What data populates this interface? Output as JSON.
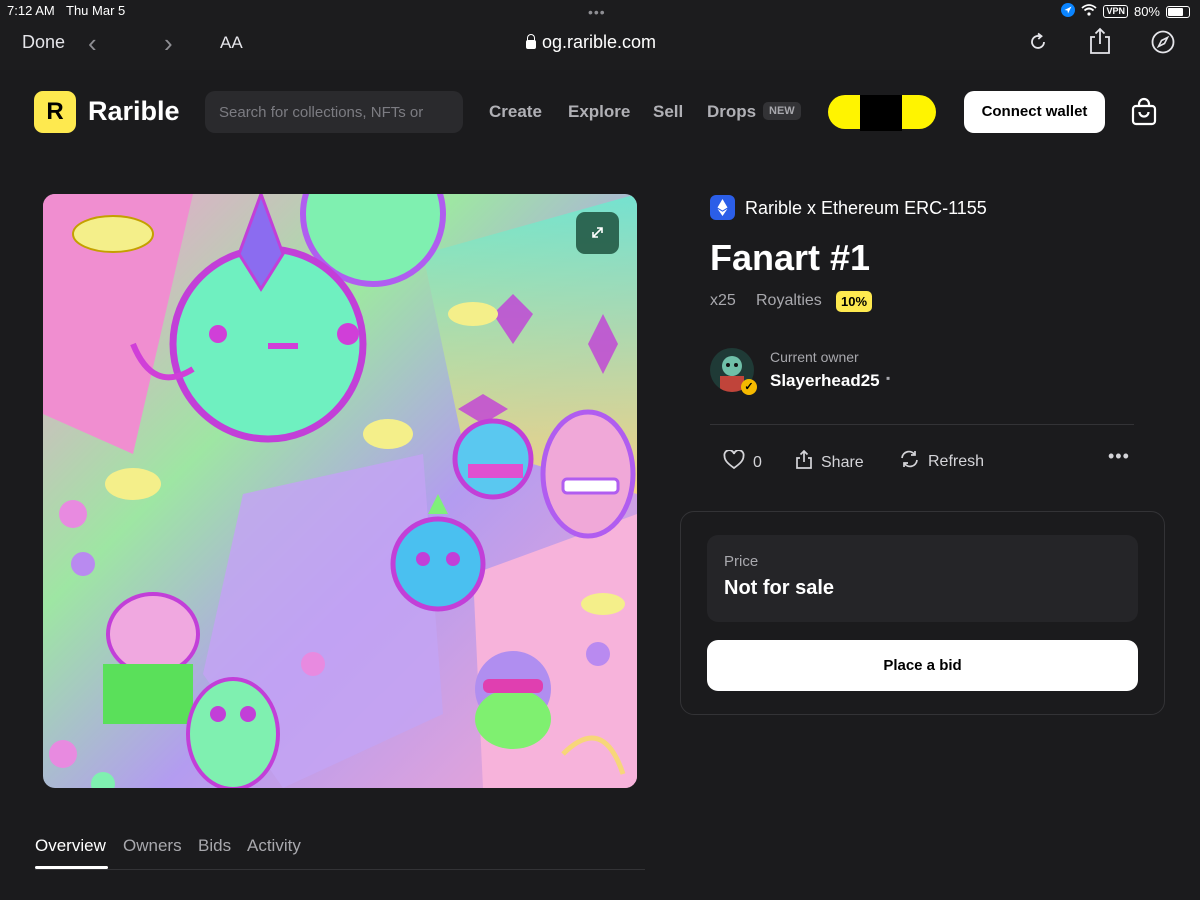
{
  "status_bar": {
    "time": "7:12 AM",
    "date": "Thu Mar 5",
    "vpn": "VPN",
    "battery": "80%"
  },
  "browser": {
    "done_label": "Done",
    "text_size_label": "AA",
    "url": "og.rarible.com"
  },
  "nav": {
    "logo_letter": "R",
    "logo_text": "Rarible",
    "search_placeholder": "Search for collections, NFTs or",
    "links": [
      "Create",
      "Explore",
      "Sell",
      "Drops"
    ],
    "new_badge": "NEW",
    "connect_label": "Connect wallet"
  },
  "nft": {
    "chain": "Rarible x Ethereum ERC-1155",
    "title": "Fanart #1",
    "edition": "x25",
    "royalties_label": "Royalties",
    "royalties_value": "10%",
    "owner_label": "Current owner",
    "owner_name": "Slayerhead25",
    "likes": "0",
    "share_label": "Share",
    "refresh_label": "Refresh"
  },
  "sale": {
    "price_label": "Price",
    "price_value": "Not for sale",
    "bid_label": "Place a bid"
  },
  "tabs": [
    "Overview",
    "Owners",
    "Bids",
    "Activity"
  ],
  "colors": {
    "accent": "#fee94f",
    "bg": "#1b1b1d",
    "chain": "#2b5ee8"
  }
}
